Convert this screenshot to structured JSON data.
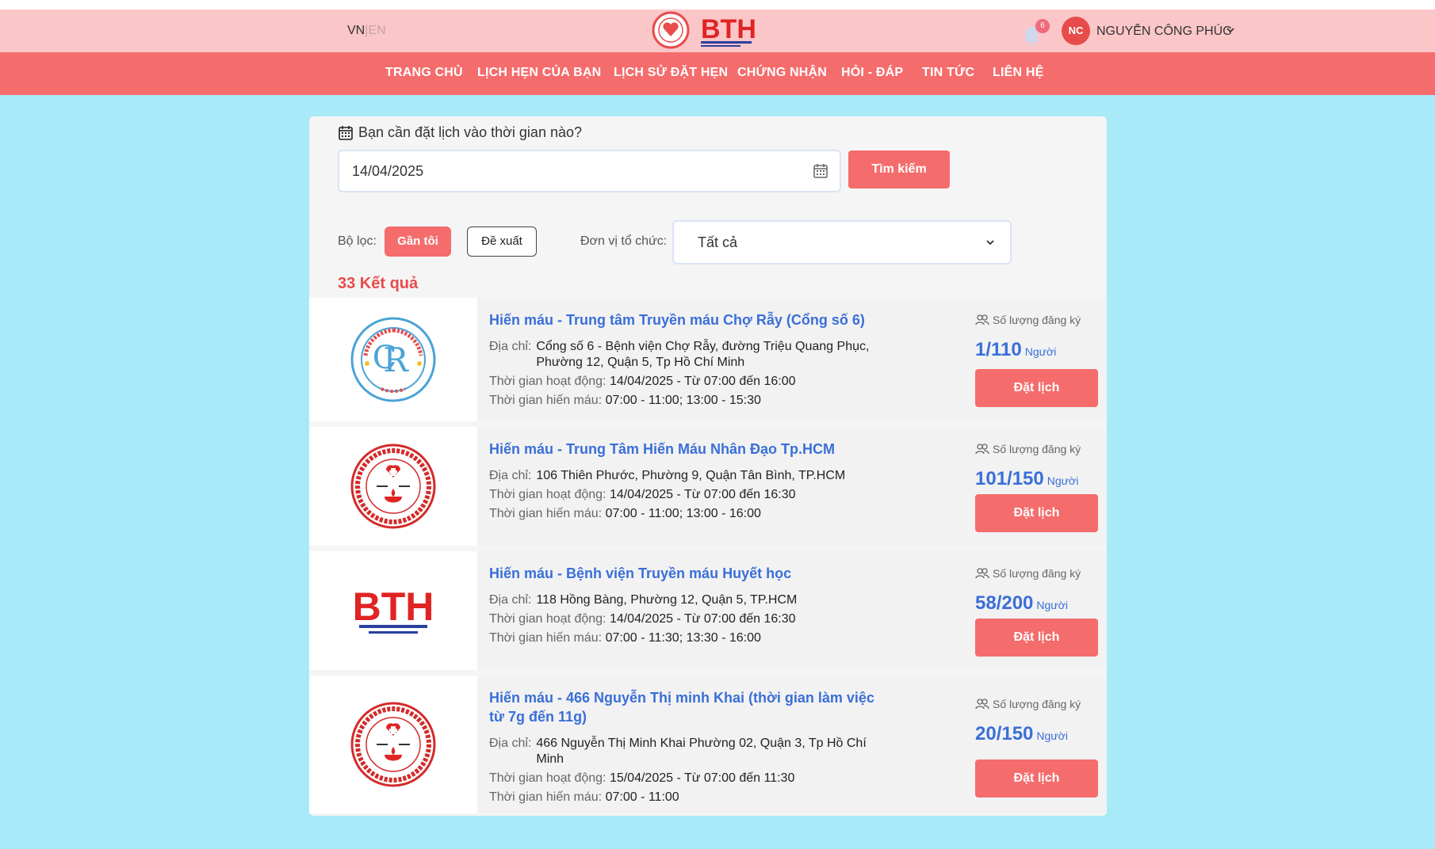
{
  "header": {
    "lang_vn": "VN",
    "lang_sep": "|",
    "lang_en": "EN",
    "logo_text": "BTH",
    "notification_count": "6",
    "avatar_initials": "NC",
    "username": "NGUYỄN CÔNG PHÚC"
  },
  "nav": [
    {
      "label": "TRANG CHỦ"
    },
    {
      "label": "LỊCH HẸN CỦA BẠN"
    },
    {
      "label": "LỊCH SỬ ĐẶT HẸN"
    },
    {
      "label": "CHỨNG NHẬN"
    },
    {
      "label": "HỎI - ĐÁP"
    },
    {
      "label": "TIN TỨC"
    },
    {
      "label": "LIÊN HỆ"
    }
  ],
  "search": {
    "question": "Bạn cần đặt lịch vào thời gian nào?",
    "date_value": "14/04/2025",
    "search_button": "Tìm kiếm"
  },
  "filter": {
    "label": "Bộ lọc:",
    "near_me": "Gần tôi",
    "suggested": "Đề xuất",
    "org_label": "Đơn vị tổ chức:",
    "org_value": "Tất cả"
  },
  "results_count": "33 Kết quả",
  "labels": {
    "address": "Địa chỉ:",
    "operating_time": "Thời gian hoạt động:",
    "donation_time": "Thời gian hiến máu:",
    "registered": "Số lượng đăng ký",
    "people_unit": "Người",
    "book": "Đặt lịch"
  },
  "events": [
    {
      "title": "Hiến máu - Trung tâm Truyền máu Chợ Rẫy (Cổng số 6)",
      "address": "Cổng số 6 - Bệnh viện Chợ Rẫy, đường Triệu Quang Phục, Phường 12, Quận 5, Tp Hồ Chí Minh",
      "operating_time": "14/04/2025 - Từ 07:00 đến 16:00",
      "donation_time": "07:00 - 11:00; 13:00 - 15:30",
      "count": "1/110",
      "logo": "cho-ray"
    },
    {
      "title": "Hiến máu - Trung Tâm Hiến Máu Nhân Đạo Tp.HCM",
      "address": "106 Thiên Phước, Phường 9, Quận Tân Bình, TP.HCM",
      "operating_time": "14/04/2025 - Từ 07:00 đến 16:30",
      "donation_time": "07:00 - 11:00; 13:00 - 16:00",
      "count": "101/150",
      "logo": "red-cross"
    },
    {
      "title": "Hiến máu - Bệnh viện Truyền máu Huyết học",
      "address": "118 Hồng Bàng, Phường 12, Quận 5, TP.HCM",
      "operating_time": "14/04/2025 - Từ 07:00 đến 16:30",
      "donation_time": "07:00 - 11:30; 13:30 - 16:00",
      "count": "58/200",
      "logo": "bth"
    },
    {
      "title": "Hiến máu - 466 Nguyễn Thị minh Khai (thời gian làm việc từ 7g đến 11g)",
      "address": "466 Nguyễn Thị Minh Khai Phường 02, Quận 3, Tp Hồ Chí Minh",
      "operating_time": "15/04/2025 - Từ 07:00 đến 11:30",
      "donation_time": "07:00 - 11:00",
      "count": "20/150",
      "logo": "red-cross"
    }
  ],
  "logo_lettering": {
    "cho_ray": "BỆNH VIỆN CHỢ RẪY 1900",
    "red_cross": "HỘI CHỮ THẬP ĐỎ TP.HCM · TRUNG TÂM HIẾN MÁU NHÂN ĐẠO",
    "bth_sub": "BỆNH VIỆN TRUYỀN MÁU HUYẾT HỌC"
  },
  "colors": {
    "header_bg": "#fbc6c7",
    "nav_bg": "#f56c6c",
    "page_bg": "#a8eaf8",
    "accent_red": "#f56c6c",
    "link_blue": "#3a6fd8"
  }
}
